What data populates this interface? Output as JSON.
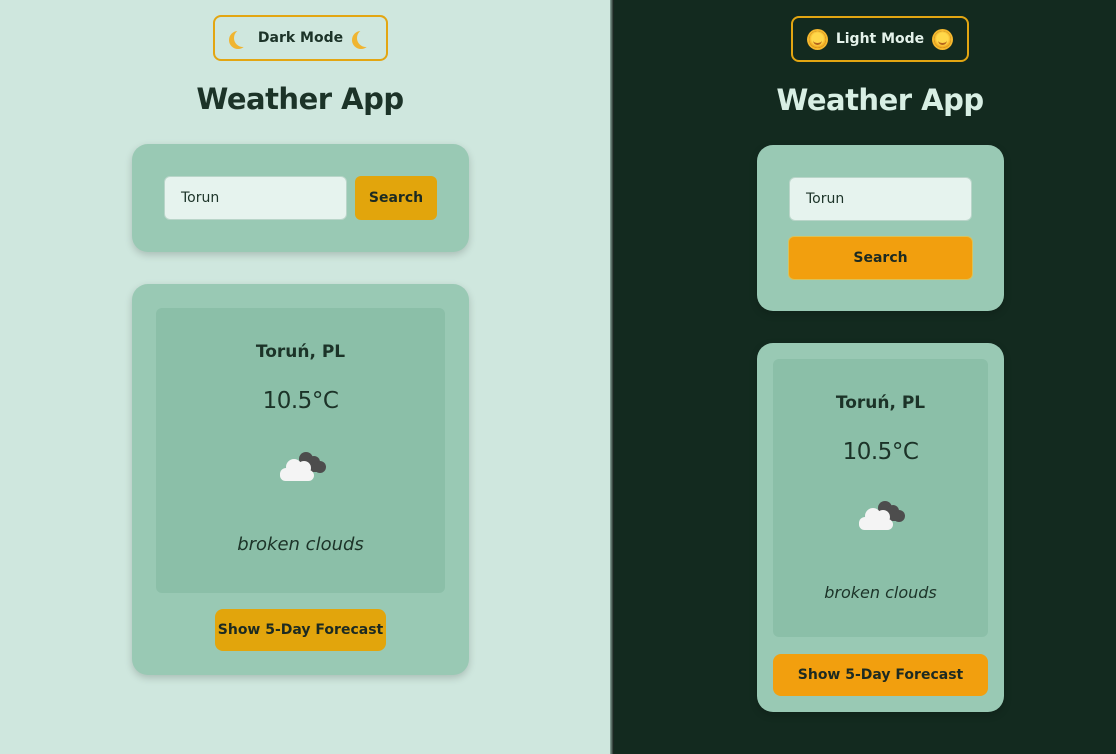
{
  "light_pane": {
    "mode_toggle_label": "Dark Mode",
    "title": "Weather App",
    "search": {
      "value": "Torun",
      "button_label": "Search"
    },
    "weather": {
      "city": "Toruń, PL",
      "temperature": "10.5°C",
      "icon": "broken-clouds-icon",
      "description": "broken clouds"
    },
    "forecast_button_label": "Show 5-Day Forecast"
  },
  "dark_pane": {
    "mode_toggle_label": "Light Mode",
    "title": "Weather App",
    "search": {
      "value": "Torun",
      "button_label": "Search"
    },
    "weather": {
      "city": "Toruń, PL",
      "temperature": "10.5°C",
      "icon": "broken-clouds-icon",
      "description": "broken clouds"
    },
    "forecast_button_label": "Show 5-Day Forecast"
  },
  "colors": {
    "light_background": "#cfe7de",
    "dark_background": "#132a1f",
    "card": "#99c9b4",
    "inner_card": "#8bbfa8",
    "accent": "#e2a50c",
    "accent_dark_mode": "#f29f0e"
  }
}
